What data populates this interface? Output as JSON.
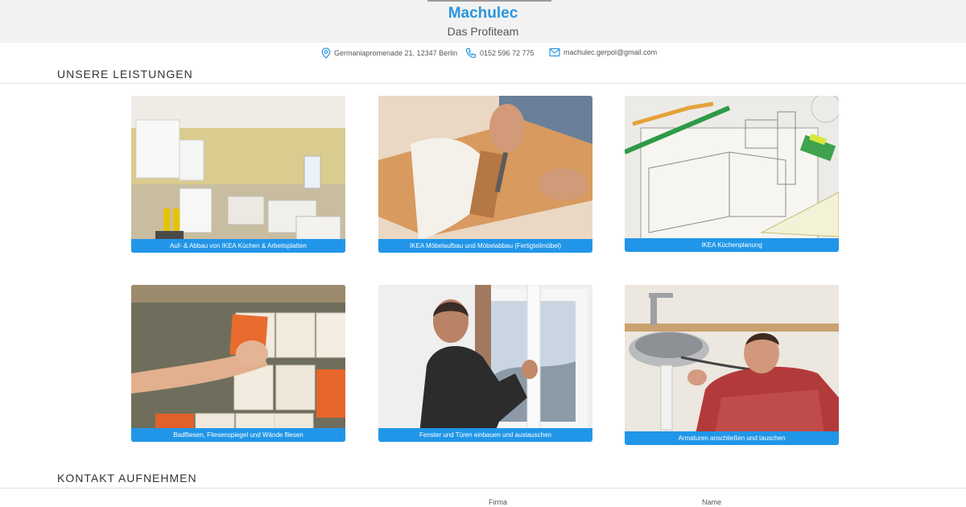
{
  "header": {
    "brand": "Machulec",
    "tagline": "Das Profiteam"
  },
  "contact": {
    "address": "Germaniapromenade 21, 12347 Berlin",
    "phone": "0152 596 72 775",
    "email": "machulec.gerpol@gmail.com"
  },
  "services": {
    "title": "UNSERE LEISTUNGEN",
    "items": [
      {
        "label": "Auf- & Abbau von IKEA Küchen & Arbeitsplatten",
        "image": "kitchen-renovation-photo"
      },
      {
        "label": "IKEA Möbelaufbau und Möbelabbau (Fertigteilmöbel)",
        "image": "furniture-assembly-photo"
      },
      {
        "label": "IKEA Küchenplanung",
        "image": "kitchen-plan-drawing-photo"
      },
      {
        "label": "Badfliesen, Fliesenspiegel und Wände fliesen",
        "image": "tiling-photo"
      },
      {
        "label": "Fenster und Türen einbauen und austauschen",
        "image": "window-installation-photo"
      },
      {
        "label": "Armaturen anschließen und tauschen",
        "image": "plumbing-photo"
      }
    ]
  },
  "contact_section": {
    "title": "KONTAKT AUFNEHMEN",
    "field_company": "Firma",
    "field_name": "Name"
  },
  "colors": {
    "accent": "#2196e8",
    "brand": "#2a96df",
    "header_bg": "#f2f2f2"
  }
}
